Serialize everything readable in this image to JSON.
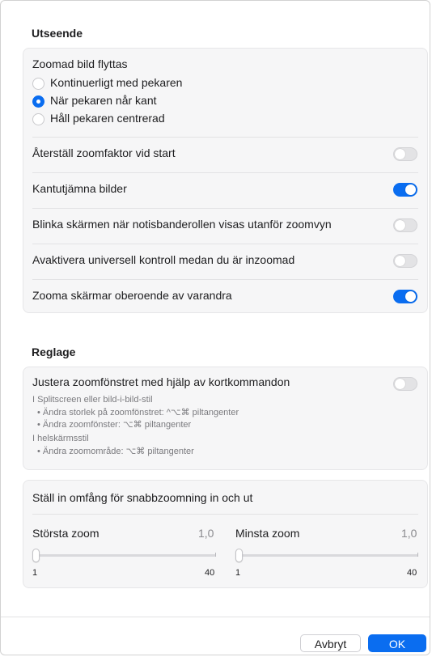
{
  "appearance": {
    "title": "Utseende",
    "zoomed_image_moves": {
      "label": "Zoomad bild flyttas",
      "options": [
        {
          "label": "Kontinuerligt med pekaren",
          "selected": false
        },
        {
          "label": "När pekaren når kant",
          "selected": true
        },
        {
          "label": "Håll pekaren centrerad",
          "selected": false
        }
      ]
    },
    "toggles": [
      {
        "label": "Återställ zoomfaktor vid start",
        "on": false
      },
      {
        "label": "Kantutjämna bilder",
        "on": true
      },
      {
        "label": "Blinka skärmen när notisbanderollen visas utanför zoomvyn",
        "on": false
      },
      {
        "label": "Avaktivera universell kontroll medan du är inzoomad",
        "on": false
      },
      {
        "label": "Zooma skärmar oberoende av varandra",
        "on": true
      }
    ]
  },
  "controls": {
    "title": "Reglage",
    "shortcut_toggle": {
      "label": "Justera zoomfönstret med hjälp av kortkommandon",
      "on": false,
      "notes": [
        "I Splitscreen eller bild-i-bild-stil",
        "• Ändra storlek på zoomfönstret: ^⌥⌘ piltangenter",
        "• Ändra zoomfönster: ⌥⌘ piltangenter",
        "I helskärmsstil",
        "• Ändra zoomområde: ⌥⌘ piltangenter"
      ]
    },
    "quick_zoom": {
      "title": "Ställ in omfång för snabbzoomning in och ut",
      "max": {
        "label": "Största zoom",
        "value": "1,0",
        "min_label": "1",
        "max_label": "40",
        "position": 0
      },
      "min": {
        "label": "Minsta zoom",
        "value": "1,0",
        "min_label": "1",
        "max_label": "40",
        "position": 0
      }
    }
  },
  "buttons": {
    "cancel": "Avbryt",
    "ok": "OK"
  },
  "colors": {
    "accent": "#0a6df0",
    "group_background": "#f6f6f7"
  }
}
